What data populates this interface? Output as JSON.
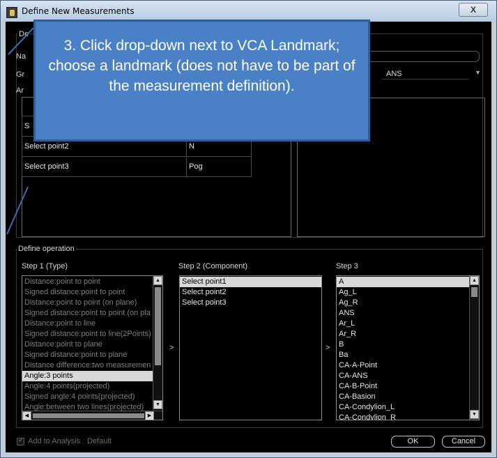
{
  "window": {
    "title": "Define New Measurements",
    "close_label": "X"
  },
  "definition": {
    "group_label_visible": "De",
    "name_label_visible": "Na",
    "group_row_label_visible": "Gr",
    "analysis_label_visible": "Ar",
    "vca_value": "ANS",
    "rows": [
      {
        "label": "S",
        "value": ""
      },
      {
        "label": "Select point2",
        "value": "N"
      },
      {
        "label": "Select point3",
        "value": "Pog"
      }
    ]
  },
  "callout": {
    "text": "3. Click drop-down next to VCA Landmark; choose a landmark (does not have to be part of the measurement definition)."
  },
  "operation": {
    "group_label": "Define operation",
    "step1_label": "Step 1 (Type)",
    "step2_label": "Step 2 (Component)",
    "step3_label": "Step 3",
    "arrow1": ">",
    "arrow2": ">",
    "step1_items": [
      {
        "label": "Distance:point to point",
        "state": "dim"
      },
      {
        "label": "Signed distance:point to point",
        "state": "dim"
      },
      {
        "label": "Distance:point to point (on plane)",
        "state": "dim"
      },
      {
        "label": "Signed distance:point to point (on pla",
        "state": "dim"
      },
      {
        "label": "Distance:point to line",
        "state": "dim"
      },
      {
        "label": "Signed distance:point to line(2Points)",
        "state": "dim"
      },
      {
        "label": "Distance:point to plane",
        "state": "dim"
      },
      {
        "label": "Signed distance:point to plane",
        "state": "dim"
      },
      {
        "label": "Distance difference:two measuremen",
        "state": "dim"
      },
      {
        "label": "Angle:3 points",
        "state": "selected"
      },
      {
        "label": "Angle:4 points(projected)",
        "state": "dim"
      },
      {
        "label": "Signed angle:4 points(projected)",
        "state": "dim"
      },
      {
        "label": "Angle:between two lines(projected)",
        "state": "dim"
      }
    ],
    "step2_items": [
      {
        "label": "Select point1",
        "state": "selected"
      },
      {
        "label": "Select point2",
        "state": "normal"
      },
      {
        "label": "Select point3",
        "state": "normal"
      }
    ],
    "step3_items": [
      {
        "label": "A",
        "state": "selected"
      },
      {
        "label": "Ag_L",
        "state": "normal"
      },
      {
        "label": "Ag_R",
        "state": "normal"
      },
      {
        "label": "ANS",
        "state": "normal"
      },
      {
        "label": "Ar_L",
        "state": "normal"
      },
      {
        "label": "Ar_R",
        "state": "normal"
      },
      {
        "label": "B",
        "state": "normal"
      },
      {
        "label": "Ba",
        "state": "normal"
      },
      {
        "label": "CA-A-Point",
        "state": "normal"
      },
      {
        "label": "CA-ANS",
        "state": "normal"
      },
      {
        "label": "CA-B-Point",
        "state": "normal"
      },
      {
        "label": "CA-Basion",
        "state": "normal"
      },
      {
        "label": "CA-Condylion_L",
        "state": "normal"
      },
      {
        "label": "CA-Condylion_R",
        "state": "normal"
      }
    ]
  },
  "footer": {
    "add_to_analysis_label": "Add to Analysis",
    "default_label": "Default",
    "ok_label": "OK",
    "cancel_label": "Cancel"
  }
}
